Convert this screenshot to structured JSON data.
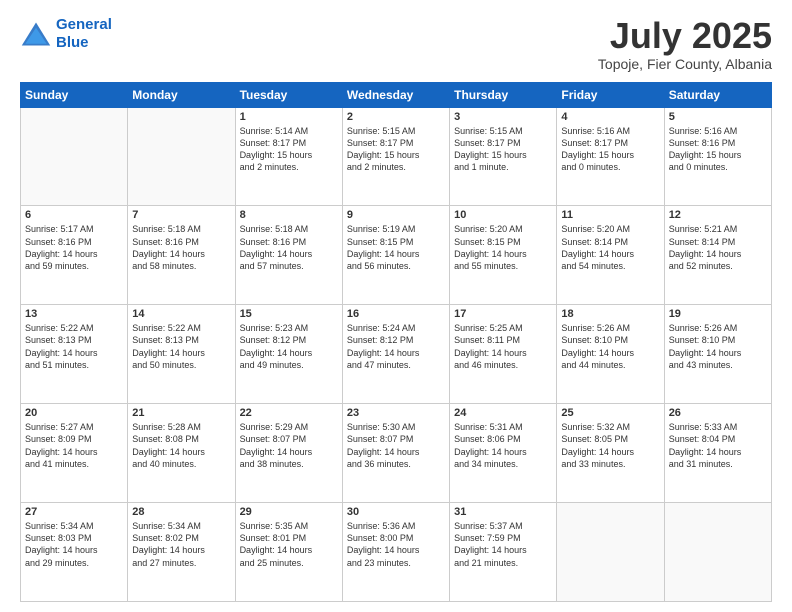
{
  "header": {
    "logo_line1": "General",
    "logo_line2": "Blue",
    "month": "July 2025",
    "location": "Topoje, Fier County, Albania"
  },
  "weekdays": [
    "Sunday",
    "Monday",
    "Tuesday",
    "Wednesday",
    "Thursday",
    "Friday",
    "Saturday"
  ],
  "weeks": [
    [
      {
        "day": "",
        "info": ""
      },
      {
        "day": "",
        "info": ""
      },
      {
        "day": "1",
        "info": "Sunrise: 5:14 AM\nSunset: 8:17 PM\nDaylight: 15 hours\nand 2 minutes."
      },
      {
        "day": "2",
        "info": "Sunrise: 5:15 AM\nSunset: 8:17 PM\nDaylight: 15 hours\nand 2 minutes."
      },
      {
        "day": "3",
        "info": "Sunrise: 5:15 AM\nSunset: 8:17 PM\nDaylight: 15 hours\nand 1 minute."
      },
      {
        "day": "4",
        "info": "Sunrise: 5:16 AM\nSunset: 8:17 PM\nDaylight: 15 hours\nand 0 minutes."
      },
      {
        "day": "5",
        "info": "Sunrise: 5:16 AM\nSunset: 8:16 PM\nDaylight: 15 hours\nand 0 minutes."
      }
    ],
    [
      {
        "day": "6",
        "info": "Sunrise: 5:17 AM\nSunset: 8:16 PM\nDaylight: 14 hours\nand 59 minutes."
      },
      {
        "day": "7",
        "info": "Sunrise: 5:18 AM\nSunset: 8:16 PM\nDaylight: 14 hours\nand 58 minutes."
      },
      {
        "day": "8",
        "info": "Sunrise: 5:18 AM\nSunset: 8:16 PM\nDaylight: 14 hours\nand 57 minutes."
      },
      {
        "day": "9",
        "info": "Sunrise: 5:19 AM\nSunset: 8:15 PM\nDaylight: 14 hours\nand 56 minutes."
      },
      {
        "day": "10",
        "info": "Sunrise: 5:20 AM\nSunset: 8:15 PM\nDaylight: 14 hours\nand 55 minutes."
      },
      {
        "day": "11",
        "info": "Sunrise: 5:20 AM\nSunset: 8:14 PM\nDaylight: 14 hours\nand 54 minutes."
      },
      {
        "day": "12",
        "info": "Sunrise: 5:21 AM\nSunset: 8:14 PM\nDaylight: 14 hours\nand 52 minutes."
      }
    ],
    [
      {
        "day": "13",
        "info": "Sunrise: 5:22 AM\nSunset: 8:13 PM\nDaylight: 14 hours\nand 51 minutes."
      },
      {
        "day": "14",
        "info": "Sunrise: 5:22 AM\nSunset: 8:13 PM\nDaylight: 14 hours\nand 50 minutes."
      },
      {
        "day": "15",
        "info": "Sunrise: 5:23 AM\nSunset: 8:12 PM\nDaylight: 14 hours\nand 49 minutes."
      },
      {
        "day": "16",
        "info": "Sunrise: 5:24 AM\nSunset: 8:12 PM\nDaylight: 14 hours\nand 47 minutes."
      },
      {
        "day": "17",
        "info": "Sunrise: 5:25 AM\nSunset: 8:11 PM\nDaylight: 14 hours\nand 46 minutes."
      },
      {
        "day": "18",
        "info": "Sunrise: 5:26 AM\nSunset: 8:10 PM\nDaylight: 14 hours\nand 44 minutes."
      },
      {
        "day": "19",
        "info": "Sunrise: 5:26 AM\nSunset: 8:10 PM\nDaylight: 14 hours\nand 43 minutes."
      }
    ],
    [
      {
        "day": "20",
        "info": "Sunrise: 5:27 AM\nSunset: 8:09 PM\nDaylight: 14 hours\nand 41 minutes."
      },
      {
        "day": "21",
        "info": "Sunrise: 5:28 AM\nSunset: 8:08 PM\nDaylight: 14 hours\nand 40 minutes."
      },
      {
        "day": "22",
        "info": "Sunrise: 5:29 AM\nSunset: 8:07 PM\nDaylight: 14 hours\nand 38 minutes."
      },
      {
        "day": "23",
        "info": "Sunrise: 5:30 AM\nSunset: 8:07 PM\nDaylight: 14 hours\nand 36 minutes."
      },
      {
        "day": "24",
        "info": "Sunrise: 5:31 AM\nSunset: 8:06 PM\nDaylight: 14 hours\nand 34 minutes."
      },
      {
        "day": "25",
        "info": "Sunrise: 5:32 AM\nSunset: 8:05 PM\nDaylight: 14 hours\nand 33 minutes."
      },
      {
        "day": "26",
        "info": "Sunrise: 5:33 AM\nSunset: 8:04 PM\nDaylight: 14 hours\nand 31 minutes."
      }
    ],
    [
      {
        "day": "27",
        "info": "Sunrise: 5:34 AM\nSunset: 8:03 PM\nDaylight: 14 hours\nand 29 minutes."
      },
      {
        "day": "28",
        "info": "Sunrise: 5:34 AM\nSunset: 8:02 PM\nDaylight: 14 hours\nand 27 minutes."
      },
      {
        "day": "29",
        "info": "Sunrise: 5:35 AM\nSunset: 8:01 PM\nDaylight: 14 hours\nand 25 minutes."
      },
      {
        "day": "30",
        "info": "Sunrise: 5:36 AM\nSunset: 8:00 PM\nDaylight: 14 hours\nand 23 minutes."
      },
      {
        "day": "31",
        "info": "Sunrise: 5:37 AM\nSunset: 7:59 PM\nDaylight: 14 hours\nand 21 minutes."
      },
      {
        "day": "",
        "info": ""
      },
      {
        "day": "",
        "info": ""
      }
    ]
  ]
}
